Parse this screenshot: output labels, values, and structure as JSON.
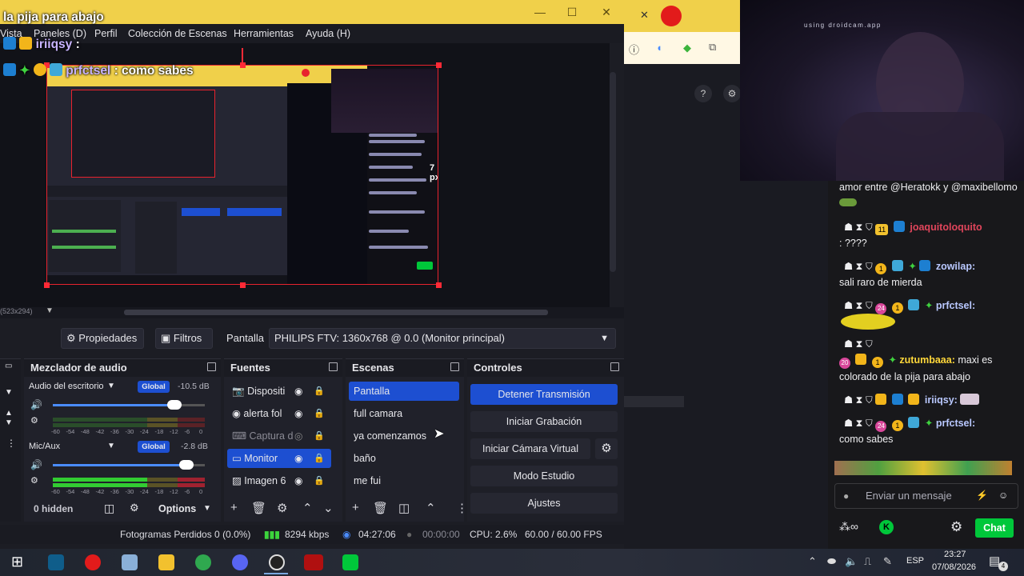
{
  "obs": {
    "menu": [
      "Vista",
      "Paneles (D)",
      "Perfil",
      "Colección de Escenas",
      "Herramientas",
      "Ayuda (H)"
    ],
    "preview_size_label": "(523x294)",
    "nested_px_label": "7 px",
    "properties_button": "Propiedades",
    "filters_button": "Filtros",
    "source_label": "Pantalla",
    "display_select": "PHILIPS FTV: 1360x768 @ 0.0 (Monitor principal)",
    "mixer": {
      "title": "Mezclador de audio",
      "channels": [
        {
          "name": "Audio del escritorio",
          "badge": "Global",
          "db": "-10.5 dB",
          "volume": 0.8
        },
        {
          "name": "Mic/Aux",
          "badge": "Global",
          "db": "-2.8 dB",
          "volume": 0.88
        }
      ],
      "scale": [
        "-60",
        "-54",
        "-48",
        "-42",
        "-36",
        "-30",
        "-24",
        "-18",
        "-12",
        "-6",
        "0"
      ],
      "hidden": "0 hidden",
      "options": "Options"
    },
    "sources": {
      "title": "Fuentes",
      "items": [
        "Dispositi",
        "alerta fol",
        "Captura d",
        "Monitor",
        "Imagen 6"
      ]
    },
    "scenes": {
      "title": "Escenas",
      "items": [
        "Pantalla",
        "full camara",
        "ya comenzamos",
        "baño",
        "me fui"
      ]
    },
    "controls": {
      "title": "Controles",
      "stop_stream": "Detener Transmisión",
      "start_recording": "Iniciar Grabación",
      "virtual_cam": "Iniciar Cámara Virtual",
      "studio_mode": "Modo Estudio",
      "settings": "Ajustes"
    },
    "status": {
      "dropped": "Fotogramas Perdidos 0 (0.0%)",
      "bitrate": "8294 kbps",
      "live_time": "04:27:06",
      "rec_time": "00:00:00",
      "cpu": "CPU: 2.6%",
      "fps": "60.00 / 60.00 FPS"
    }
  },
  "overlay_chat": [
    {
      "user": "",
      "text": "la pija para abajo"
    },
    {
      "user": "iriiqsy",
      "text": ":"
    },
    {
      "user": "prfctsel",
      "text": ": como sabes"
    }
  ],
  "cam": {
    "watermark": "using droidcam.app"
  },
  "twitch": {
    "messages": [
      {
        "user": "",
        "text": "amor entre @Heratokk y @maxibellomo"
      },
      {
        "user": "joaquitoloquito",
        "text": ": ????",
        "color": "#e0455b"
      },
      {
        "user": "zowilap:",
        "text": "sali raro de mierda",
        "color": "#b9c8ff"
      },
      {
        "user": "prfctsel:",
        "text": "",
        "color": "#b9c8ff"
      },
      {
        "user": "zutumbaaa:",
        "text": "maxi es colorado de la pija para abajo",
        "color": "#ffd83a"
      },
      {
        "user": "iriiqsy:",
        "text": "",
        "color": "#b9c8ff"
      },
      {
        "user": "prfctsel:",
        "text": "como sabes",
        "color": "#b9c8ff"
      }
    ],
    "numbers": [
      "11",
      "1",
      "24",
      "1",
      "20",
      "1",
      "24",
      "1"
    ],
    "input_placeholder": "Enviar un mensaje",
    "chat_button": "Chat"
  },
  "taskbar": {
    "lang": "ESP",
    "time": "23:27",
    "date": "07/08/2026",
    "notif": "4"
  },
  "colors": {
    "accent": "#1d4fd1",
    "record": "#e8232e",
    "twitch_green": "#00c73a",
    "title_yellow": "#f0d04a"
  }
}
